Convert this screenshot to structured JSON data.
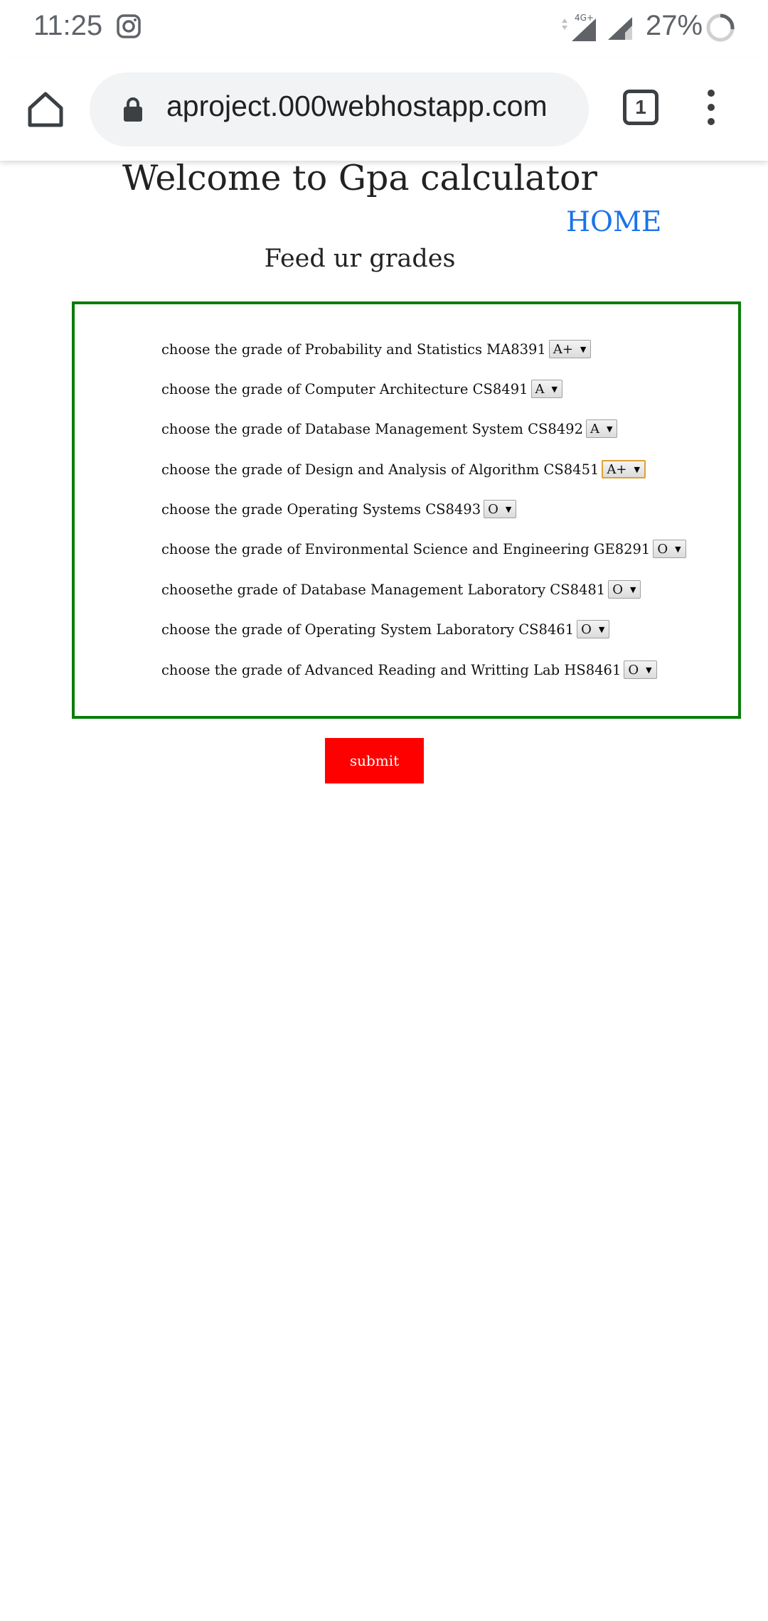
{
  "status_bar": {
    "time": "11:25",
    "network_label": "4G+",
    "battery_percent": "27%",
    "battery_level": 0.27,
    "icons": [
      "instagram-icon",
      "signal-icon",
      "battery-icon"
    ]
  },
  "browser": {
    "url": "aproject.000webhostapp.com",
    "tab_count": "1",
    "icons": [
      "home-icon",
      "lock-icon",
      "tabs-icon",
      "more-menu-icon"
    ]
  },
  "page": {
    "title": "Welcome to Gpa calculator",
    "home_link": "HOME",
    "subtitle": "Feed ur grades",
    "grades": [
      {
        "label": "choose the grade of Probability and Statistics MA8391",
        "value": "A+"
      },
      {
        "label": "choose the grade of Computer Architecture CS8491",
        "value": "A"
      },
      {
        "label": "choose the grade of Database Management System CS8492",
        "value": "A"
      },
      {
        "label": "choose the grade of Design and Analysis of Algorithm CS8451",
        "value": "A+"
      },
      {
        "label": "choose the grade Operating Systems CS8493",
        "value": "O"
      },
      {
        "label": "choose the grade of Environmental Science and Engineering GE8291",
        "value": "O"
      },
      {
        "label": "choosethe grade of Database Management Laboratory CS8481",
        "value": "O"
      },
      {
        "label": "choose the grade of Operating System Laboratory CS8461",
        "value": "O"
      },
      {
        "label": "choose the grade of Advanced Reading and Writting Lab HS8461",
        "value": "O"
      }
    ],
    "submit_label": "submit",
    "colors": {
      "box_border": "#0a7d0a",
      "submit_bg": "#ff0000",
      "link": "#1a73e8"
    }
  }
}
